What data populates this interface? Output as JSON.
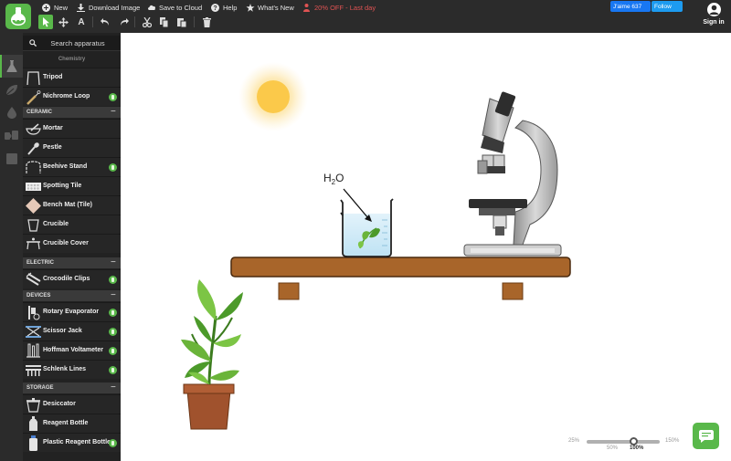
{
  "topbar": {
    "menu": [
      {
        "label": "New",
        "icon": "plus-circle-icon"
      },
      {
        "label": "Download Image",
        "icon": "download-icon"
      },
      {
        "label": "Save to Cloud",
        "icon": "cloud-icon"
      },
      {
        "label": "Help",
        "icon": "help-icon"
      },
      {
        "label": "What's New",
        "icon": "star-icon"
      },
      {
        "label": "20% OFF - Last day",
        "icon": "gift-icon"
      }
    ],
    "tools": [
      {
        "name": "select-tool",
        "glyph": "➚",
        "active": true
      },
      {
        "name": "move-tool",
        "glyph": "✥"
      },
      {
        "name": "text-tool",
        "glyph": "A"
      },
      {
        "name": "undo",
        "glyph": "↶"
      },
      {
        "name": "redo",
        "glyph": "↷"
      },
      {
        "name": "cut",
        "glyph": "✂"
      },
      {
        "name": "copy",
        "glyph": "⧉"
      },
      {
        "name": "paste",
        "glyph": "⎘"
      },
      {
        "name": "delete",
        "glyph": "🗑"
      }
    ],
    "facebook_label": "J'aime 637",
    "twitter_label": "Follow",
    "sign_in_label": "Sign in"
  },
  "rail": {
    "tabs": [
      "chemistry-flask-icon",
      "biology-leaf-icon",
      "drop-icon",
      "physics-icon",
      "generic-box-icon"
    ],
    "active": 0
  },
  "sidebar": {
    "search_placeholder": "Search apparatus",
    "category_title": "Chemistry",
    "items": [
      {
        "label": "Tripod",
        "premium": false,
        "thumb": "tripod"
      },
      {
        "label": "Nichrome Loop",
        "premium": true,
        "thumb": "loop"
      }
    ],
    "sections": [
      {
        "title": "CERAMIC",
        "items": [
          {
            "label": "Mortar",
            "premium": false,
            "thumb": "mortar"
          },
          {
            "label": "Pestle",
            "premium": false,
            "thumb": "pestle"
          },
          {
            "label": "Beehive Stand",
            "premium": true,
            "thumb": "beehive"
          },
          {
            "label": "Spotting Tile",
            "premium": false,
            "thumb": "tile"
          },
          {
            "label": "Bench Mat (Tile)",
            "premium": false,
            "thumb": "benchmat"
          },
          {
            "label": "Crucible",
            "premium": false,
            "thumb": "crucible"
          },
          {
            "label": "Crucible Cover",
            "premium": false,
            "thumb": "cover"
          }
        ]
      },
      {
        "title": "ELECTRIC",
        "items": [
          {
            "label": "Crocodile Clips",
            "premium": true,
            "thumb": "clips"
          }
        ]
      },
      {
        "title": "DEVICES",
        "items": [
          {
            "label": "Rotary Evaporator",
            "premium": true,
            "thumb": "rotary"
          },
          {
            "label": "Scissor Jack",
            "premium": true,
            "thumb": "jack"
          },
          {
            "label": "Hoffman Voltameter",
            "premium": true,
            "thumb": "voltameter"
          },
          {
            "label": "Schlenk Lines",
            "premium": true,
            "thumb": "schlenk"
          }
        ]
      },
      {
        "title": "STORAGE",
        "items": [
          {
            "label": "Desiccator",
            "premium": false,
            "thumb": "desiccator"
          },
          {
            "label": "Reagent Bottle",
            "premium": false,
            "thumb": "bottle"
          },
          {
            "label": "Plastic Reagent Bottle",
            "premium": true,
            "thumb": "plastic"
          }
        ]
      }
    ]
  },
  "canvas": {
    "label_h2o_main": "H",
    "label_h2o_sub": "2",
    "label_h2o_end": "O",
    "objects": [
      "sun",
      "table",
      "beaker-with-leaf",
      "microscope",
      "potted-plant"
    ]
  },
  "zoom": {
    "min": "25%",
    "mid": "50%",
    "max": "150%",
    "current": "100%",
    "level": 1.0
  },
  "colors": {
    "accent": "#59b84a",
    "toolbar": "#2b2b2b",
    "promo": "#e05353"
  }
}
